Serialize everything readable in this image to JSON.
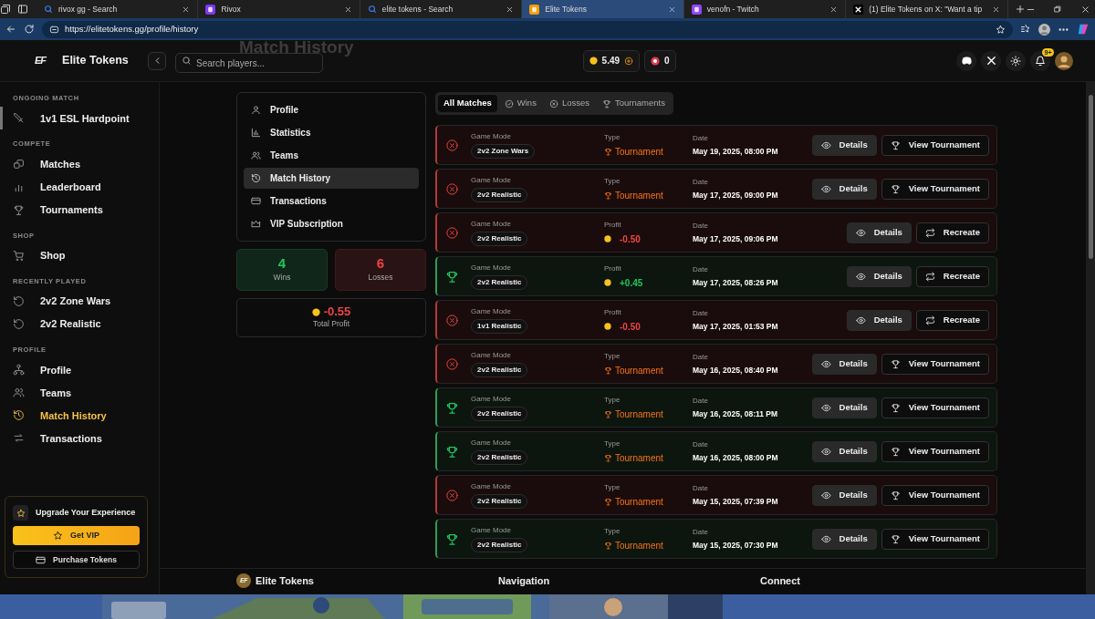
{
  "browser": {
    "tabs": [
      {
        "title": "rivox gg - Search",
        "selected": false
      },
      {
        "title": "Rivox",
        "selected": false
      },
      {
        "title": "elite tokens - Search",
        "selected": false
      },
      {
        "title": "Elite Tokens",
        "selected": true
      },
      {
        "title": "venofn - Twitch",
        "selected": false
      },
      {
        "title": "(1) Elite Tokens on X: \"Want a tip",
        "selected": false
      }
    ],
    "url": "https://elitetokens.gg/profile/history"
  },
  "header": {
    "brand_mark": "EF",
    "brand": "Elite Tokens",
    "page_title": "Match History",
    "search": {
      "placeholder": "Search players..."
    },
    "balance": "5.49",
    "tickets": "0",
    "notifications": "9+"
  },
  "sidebar": {
    "sections": [
      {
        "heading": "ONGOING MATCH",
        "items": [
          {
            "label": "1v1 ESL Hardpoint",
            "selected": false,
            "kind": "ongoing"
          }
        ]
      },
      {
        "heading": "COMPETE",
        "items": [
          {
            "label": "Matches",
            "selected": false,
            "kind": "link"
          },
          {
            "label": "Leaderboard",
            "selected": false,
            "kind": "link"
          },
          {
            "label": "Tournaments",
            "selected": false,
            "kind": "link"
          }
        ]
      },
      {
        "heading": "SHOP",
        "items": [
          {
            "label": "Shop",
            "selected": false,
            "kind": "link"
          }
        ]
      },
      {
        "heading": "RECENTLY PLAYED",
        "items": [
          {
            "label": "2v2 Zone Wars",
            "selected": false,
            "kind": "link"
          },
          {
            "label": "2v2 Realistic",
            "selected": false,
            "kind": "link"
          }
        ]
      },
      {
        "heading": "PROFILE",
        "items": [
          {
            "label": "Profile",
            "selected": false,
            "kind": "link"
          },
          {
            "label": "Teams",
            "selected": false,
            "kind": "link"
          },
          {
            "label": "Match History",
            "selected": true,
            "kind": "link"
          },
          {
            "label": "Transactions",
            "selected": false,
            "kind": "link"
          }
        ]
      }
    ],
    "upgrade": {
      "title": "Upgrade Your Experience",
      "primary": "Get VIP",
      "secondary": "Purchase Tokens"
    }
  },
  "profile_nav": [
    {
      "label": "Profile",
      "selected": false
    },
    {
      "label": "Statistics",
      "selected": false
    },
    {
      "label": "Teams",
      "selected": false
    },
    {
      "label": "Match History",
      "selected": true
    },
    {
      "label": "Transactions",
      "selected": false
    },
    {
      "label": "VIP Subscription",
      "selected": false
    }
  ],
  "stats": {
    "wins": "4",
    "wins_label": "Wins",
    "losses": "6",
    "losses_label": "Losses",
    "profit": "-0.55",
    "profit_label": "Total Profit"
  },
  "filters": [
    {
      "label": "All Matches",
      "selected": true
    },
    {
      "label": "Wins",
      "selected": false
    },
    {
      "label": "Losses",
      "selected": false
    },
    {
      "label": "Tournaments",
      "selected": false
    }
  ],
  "matches": [
    {
      "won": false,
      "mode_label": "Game Mode",
      "mode": "2v2 Zone Wars",
      "kind": "tournament",
      "info_label": "Type",
      "info": "Tournament",
      "date_label": "Date",
      "date": "May 19, 2025, 08:00 PM",
      "actions": [
        "Details",
        "View Tournament"
      ]
    },
    {
      "won": false,
      "mode_label": "Game Mode",
      "mode": "2v2 Realistic",
      "kind": "tournament",
      "info_label": "Type",
      "info": "Tournament",
      "date_label": "Date",
      "date": "May 17, 2025, 09:00 PM",
      "actions": [
        "Details",
        "View Tournament"
      ]
    },
    {
      "won": false,
      "mode_label": "Game Mode",
      "mode": "2v2 Realistic",
      "kind": "profit",
      "info_label": "Profit",
      "info": "-0.50",
      "date_label": "Date",
      "date": "May 17, 2025, 09:06 PM",
      "actions": [
        "Details",
        "Recreate"
      ]
    },
    {
      "won": true,
      "mode_label": "Game Mode",
      "mode": "2v2 Realistic",
      "kind": "profit",
      "info_label": "Profit",
      "info": "+0.45",
      "date_label": "Date",
      "date": "May 17, 2025, 08:26 PM",
      "actions": [
        "Details",
        "Recreate"
      ]
    },
    {
      "won": false,
      "mode_label": "Game Mode",
      "mode": "1v1 Realistic",
      "kind": "profit",
      "info_label": "Profit",
      "info": "-0.50",
      "date_label": "Date",
      "date": "May 17, 2025, 01:53 PM",
      "actions": [
        "Details",
        "Recreate"
      ]
    },
    {
      "won": false,
      "mode_label": "Game Mode",
      "mode": "2v2 Realistic",
      "kind": "tournament",
      "info_label": "Type",
      "info": "Tournament",
      "date_label": "Date",
      "date": "May 16, 2025, 08:40 PM",
      "actions": [
        "Details",
        "View Tournament"
      ]
    },
    {
      "won": true,
      "mode_label": "Game Mode",
      "mode": "2v2 Realistic",
      "kind": "tournament",
      "info_label": "Type",
      "info": "Tournament",
      "date_label": "Date",
      "date": "May 16, 2025, 08:11 PM",
      "actions": [
        "Details",
        "View Tournament"
      ]
    },
    {
      "won": true,
      "mode_label": "Game Mode",
      "mode": "2v2 Realistic",
      "kind": "tournament",
      "info_label": "Type",
      "info": "Tournament",
      "date_label": "Date",
      "date": "May 16, 2025, 08:00 PM",
      "actions": [
        "Details",
        "View Tournament"
      ]
    },
    {
      "won": false,
      "mode_label": "Game Mode",
      "mode": "2v2 Realistic",
      "kind": "tournament",
      "info_label": "Type",
      "info": "Tournament",
      "date_label": "Date",
      "date": "May 15, 2025, 07:39 PM",
      "actions": [
        "Details",
        "View Tournament"
      ]
    },
    {
      "won": true,
      "mode_label": "Game Mode",
      "mode": "2v2 Realistic",
      "kind": "tournament",
      "info_label": "Type",
      "info": "Tournament",
      "date_label": "Date",
      "date": "May 15, 2025, 07:30 PM",
      "actions": [
        "Details",
        "View Tournament"
      ]
    }
  ],
  "footer": {
    "brand_mark": "EF",
    "brand": "Elite Tokens",
    "columns": [
      "Navigation",
      "Connect"
    ]
  }
}
